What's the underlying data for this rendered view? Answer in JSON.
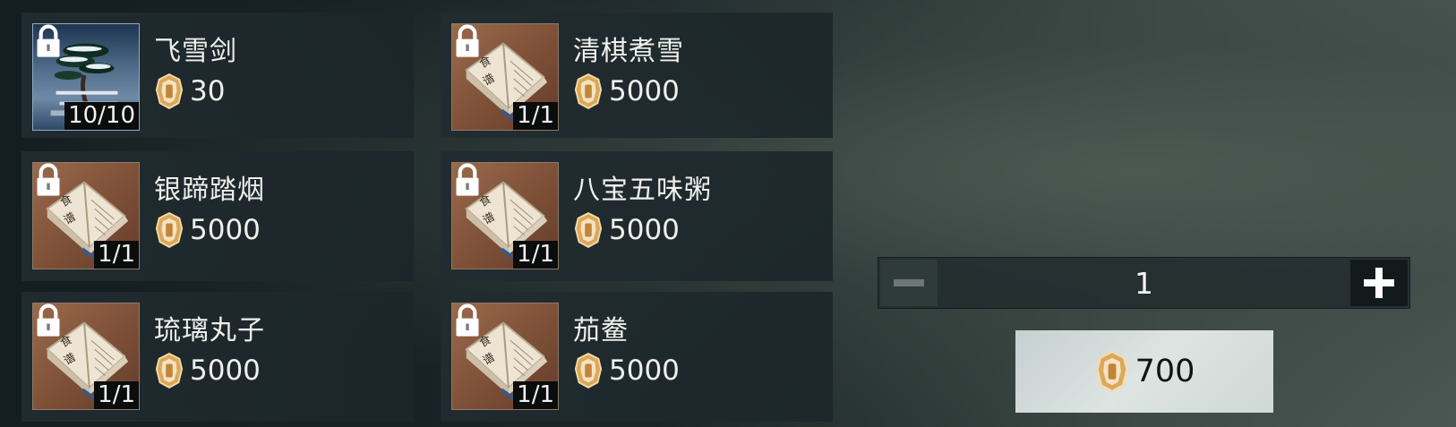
{
  "items": [
    {
      "name": "飞雪剑",
      "price": "30",
      "count": "10/10",
      "icon": "sword-pine-icon"
    },
    {
      "name": "清棋煮雪",
      "price": "5000",
      "count": "1/1",
      "icon": "recipe-book-icon"
    },
    {
      "name": "银蹄踏烟",
      "price": "5000",
      "count": "1/1",
      "icon": "recipe-book-icon"
    },
    {
      "name": "八宝五味粥",
      "price": "5000",
      "count": "1/1",
      "icon": "recipe-book-icon"
    },
    {
      "name": "琉璃丸子",
      "price": "5000",
      "count": "1/1",
      "icon": "recipe-book-icon"
    },
    {
      "name": "茄鲞",
      "price": "5000",
      "count": "1/1",
      "icon": "recipe-book-icon"
    }
  ],
  "quantity": {
    "value": "1",
    "minus_icon": "minus-icon",
    "plus_icon": "plus-icon"
  },
  "purchase": {
    "price": "700",
    "icon": "token-icon"
  },
  "colors": {
    "token_gold": "#d9a85c",
    "card_bg": "#1f2b2f",
    "buy_button": "#d3dbd9"
  }
}
